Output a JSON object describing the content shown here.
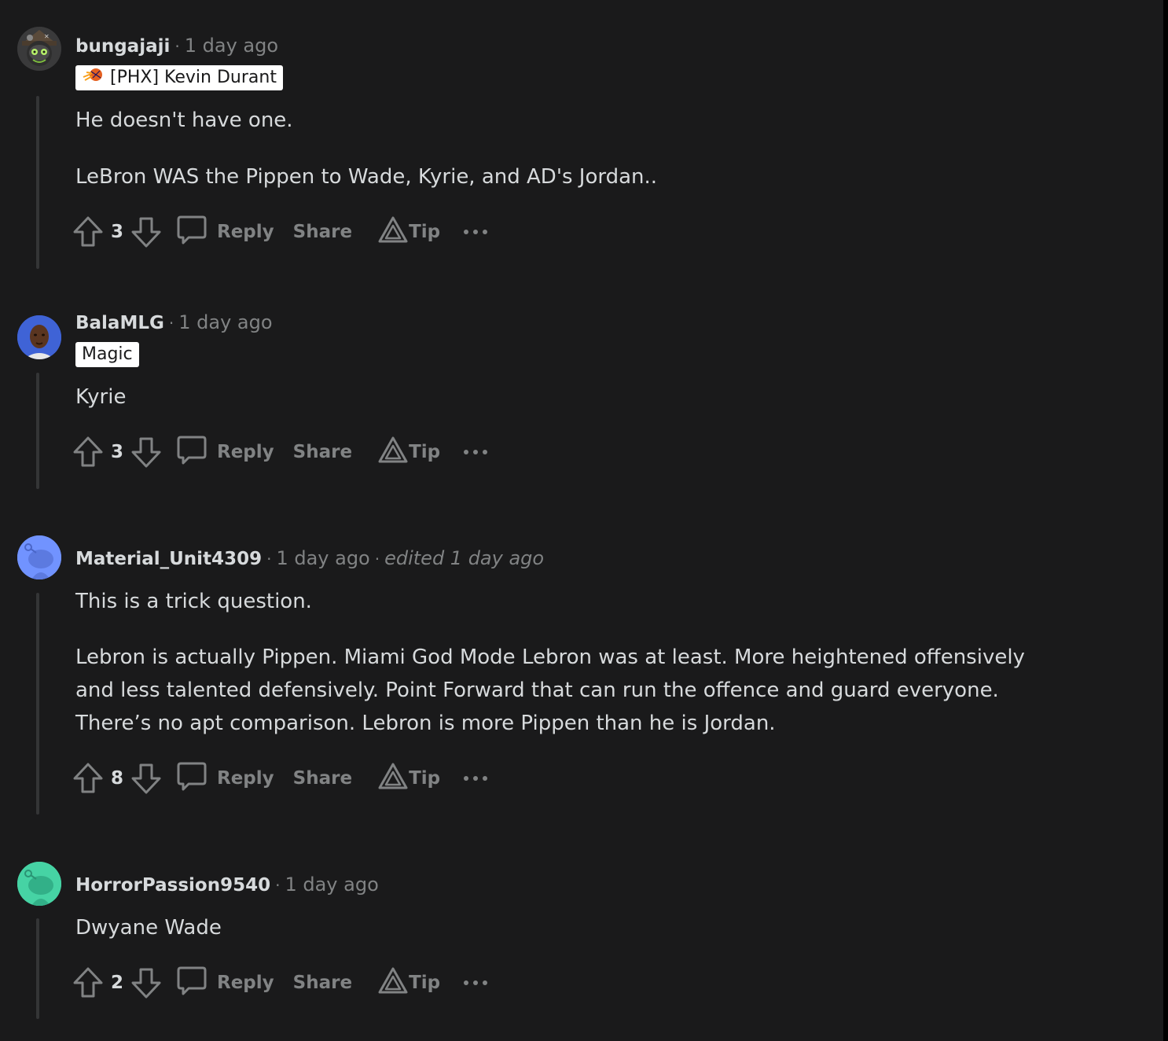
{
  "comments": [
    {
      "author": "bungajaji",
      "time": "1 day ago",
      "flair": "[PHX] Kevin Durant",
      "paragraphs": [
        "He doesn't have one.",
        "LeBron WAS the Pippen to Wade, Kyrie, and AD's Jordan.."
      ],
      "votes": "3",
      "avatar_icon": "snoo-pirate-avatar-icon"
    },
    {
      "author": "BalaMLG",
      "time": "1 day ago",
      "flair": "Magic",
      "paragraphs": [
        "Kyrie"
      ],
      "votes": "3",
      "avatar_icon": "player-photo-avatar-icon"
    },
    {
      "author": "Material_Unit4309",
      "time": "1 day ago",
      "edited": "edited 1 day ago",
      "paragraphs": [
        "This is a trick question.",
        "Lebron is actually Pippen. Miami God Mode Lebron was at least. More heightened offensively and less talented defensively. Point Forward that can run the offence and guard everyone. There’s no apt comparison. Lebron is more Pippen than he is Jordan."
      ],
      "votes": "8",
      "avatar_icon": "default-snoo-avatar-icon"
    },
    {
      "author": "HorrorPassion9540",
      "time": "1 day ago",
      "paragraphs": [
        "Dwyane Wade"
      ],
      "votes": "2",
      "avatar_icon": "default-snoo-avatar-icon"
    }
  ],
  "actions": {
    "reply": "Reply",
    "share": "Share",
    "tip": "Tip"
  },
  "colors": {
    "background": "#1a1a1b",
    "text": "#d7dadc",
    "muted": "#818384",
    "thread_line": "#343536",
    "avatar_blue": "#7193ff",
    "avatar_green": "#46d3a4"
  }
}
